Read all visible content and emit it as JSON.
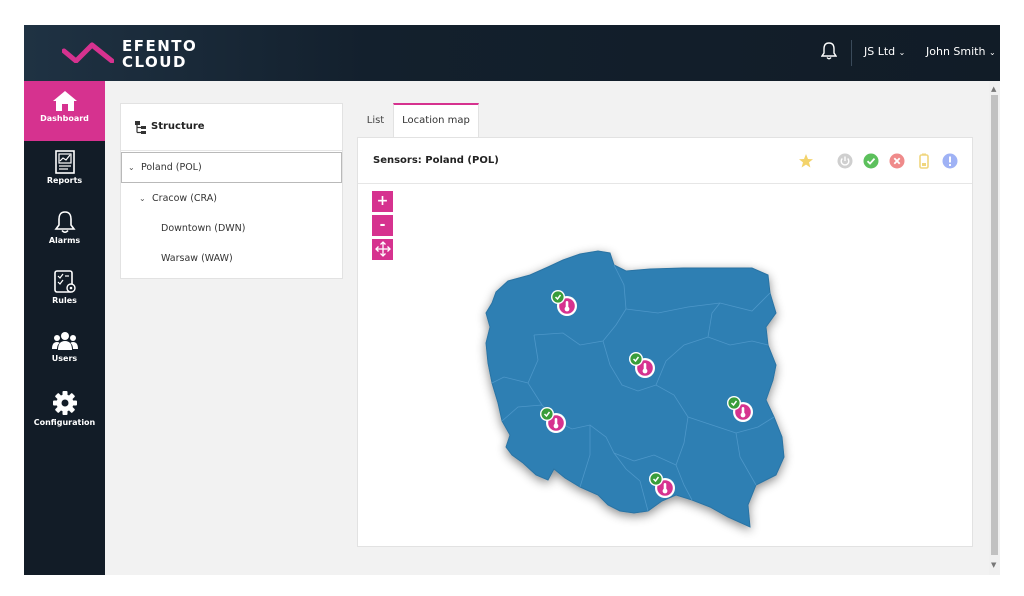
{
  "app": {
    "logo_line1": "EFENTO",
    "logo_line2": "CLOUD",
    "brand_color": "#d6328f"
  },
  "header": {
    "company": "JS Ltd",
    "user": "John Smith",
    "bell_icon": "bell-icon",
    "chevron_icon": "chevron-down-icon"
  },
  "sidebar": {
    "items": [
      {
        "label": "Dashboard",
        "icon": "home-icon",
        "active": true
      },
      {
        "label": "Reports",
        "icon": "reports-icon"
      },
      {
        "label": "Alarms",
        "icon": "bell-icon"
      },
      {
        "label": "Rules",
        "icon": "rules-icon"
      },
      {
        "label": "Users",
        "icon": "users-icon"
      },
      {
        "label": "Configuration",
        "icon": "gear-icon"
      }
    ]
  },
  "structure": {
    "title": "Structure",
    "tree": [
      {
        "label": "Poland (POL)",
        "expanded": true,
        "selected": true
      },
      {
        "label": "Cracow (CRA)",
        "expanded": true
      },
      {
        "label": "Downtown (DWN)"
      },
      {
        "label": "Warsaw (WAW)"
      }
    ]
  },
  "tabs": [
    {
      "label": "List"
    },
    {
      "label": "Location map",
      "active": true
    }
  ],
  "map": {
    "title": "Sensors: Poland (POL)",
    "zoom_in": "+",
    "zoom_out": "-",
    "filters": [
      {
        "name": "favourite-star-icon",
        "color": "#f3d36b"
      },
      {
        "name": "power-icon",
        "color": "#cfcfcf"
      },
      {
        "name": "ok-check-icon",
        "color": "#5cc05c"
      },
      {
        "name": "error-x-icon",
        "color": "#ef8a8a"
      },
      {
        "name": "battery-icon",
        "color": "#f0d67e"
      },
      {
        "name": "info-icon",
        "color": "#9fb2f5"
      }
    ],
    "map_color": "#2f7fb3",
    "sensor_status": "ok",
    "sensor_count": 5
  }
}
